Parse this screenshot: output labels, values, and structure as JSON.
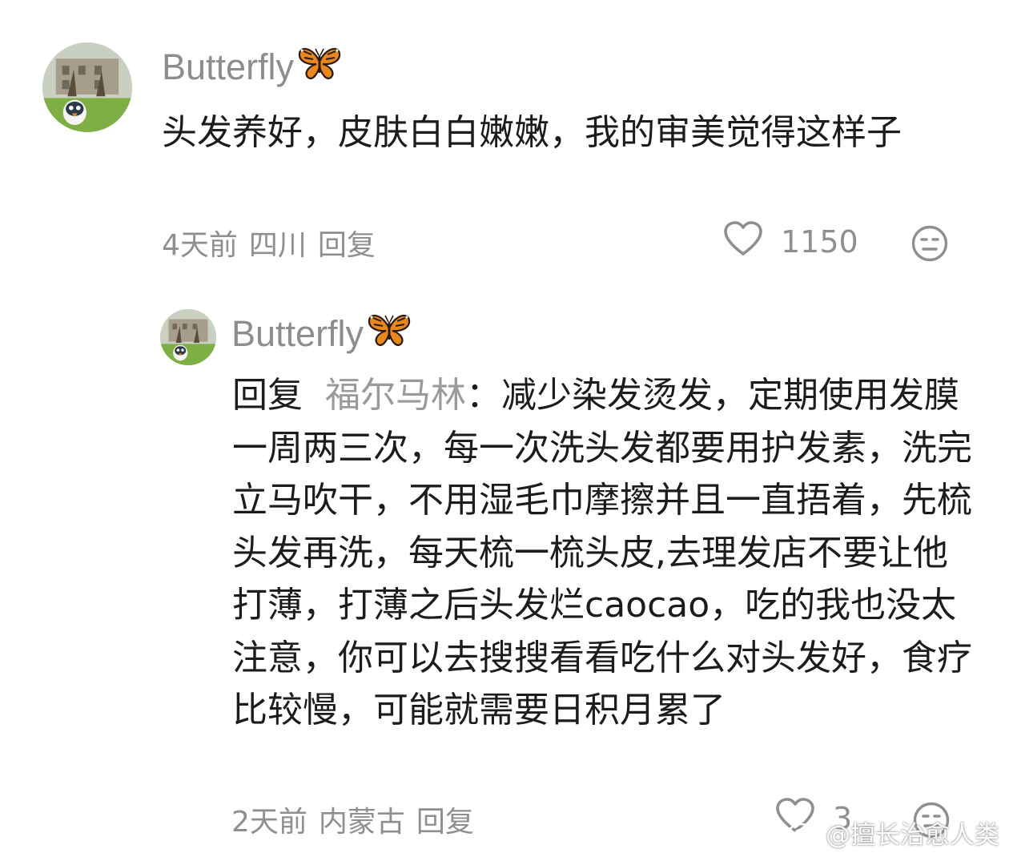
{
  "comments": [
    {
      "username": "Butterfly",
      "text": "头发养好，皮肤白白嫩嫩，我的审美觉得这样子",
      "time": "4天前",
      "location": "四川",
      "reply_label": "回复",
      "likes": "1150"
    }
  ],
  "reply": {
    "username": "Butterfly",
    "prefix": "回复",
    "target": "福尔马林",
    "text": "：减少染发烫发，定期使用发膜一周两三次，每一次洗头发都要用护发素，洗完立马吹干，不用湿毛巾摩擦并且一直捂着，先梳头发再洗，每天梳一梳头皮,去理发店不要让他打薄，打薄之后头发烂caocao，吃的我也没太注意，你可以去搜搜看看吃什么对头发好，食疗比较慢，可能就需要日积月累了",
    "time": "2天前",
    "location": "内蒙古",
    "reply_label": "回复",
    "likes": "3"
  },
  "watermark": "@擅长治愈人类",
  "icons": {
    "like": "heart-outline-icon",
    "dislike": "unhappy-face-icon",
    "butterfly": "butterfly-emoji-icon",
    "weibo": "weibo-logo-icon"
  },
  "colors": {
    "meta_gray": "#8f8f8f",
    "username_gray": "#8d8d8d",
    "text": "#1c1c1c",
    "butterfly_orange": "#e8871e"
  }
}
